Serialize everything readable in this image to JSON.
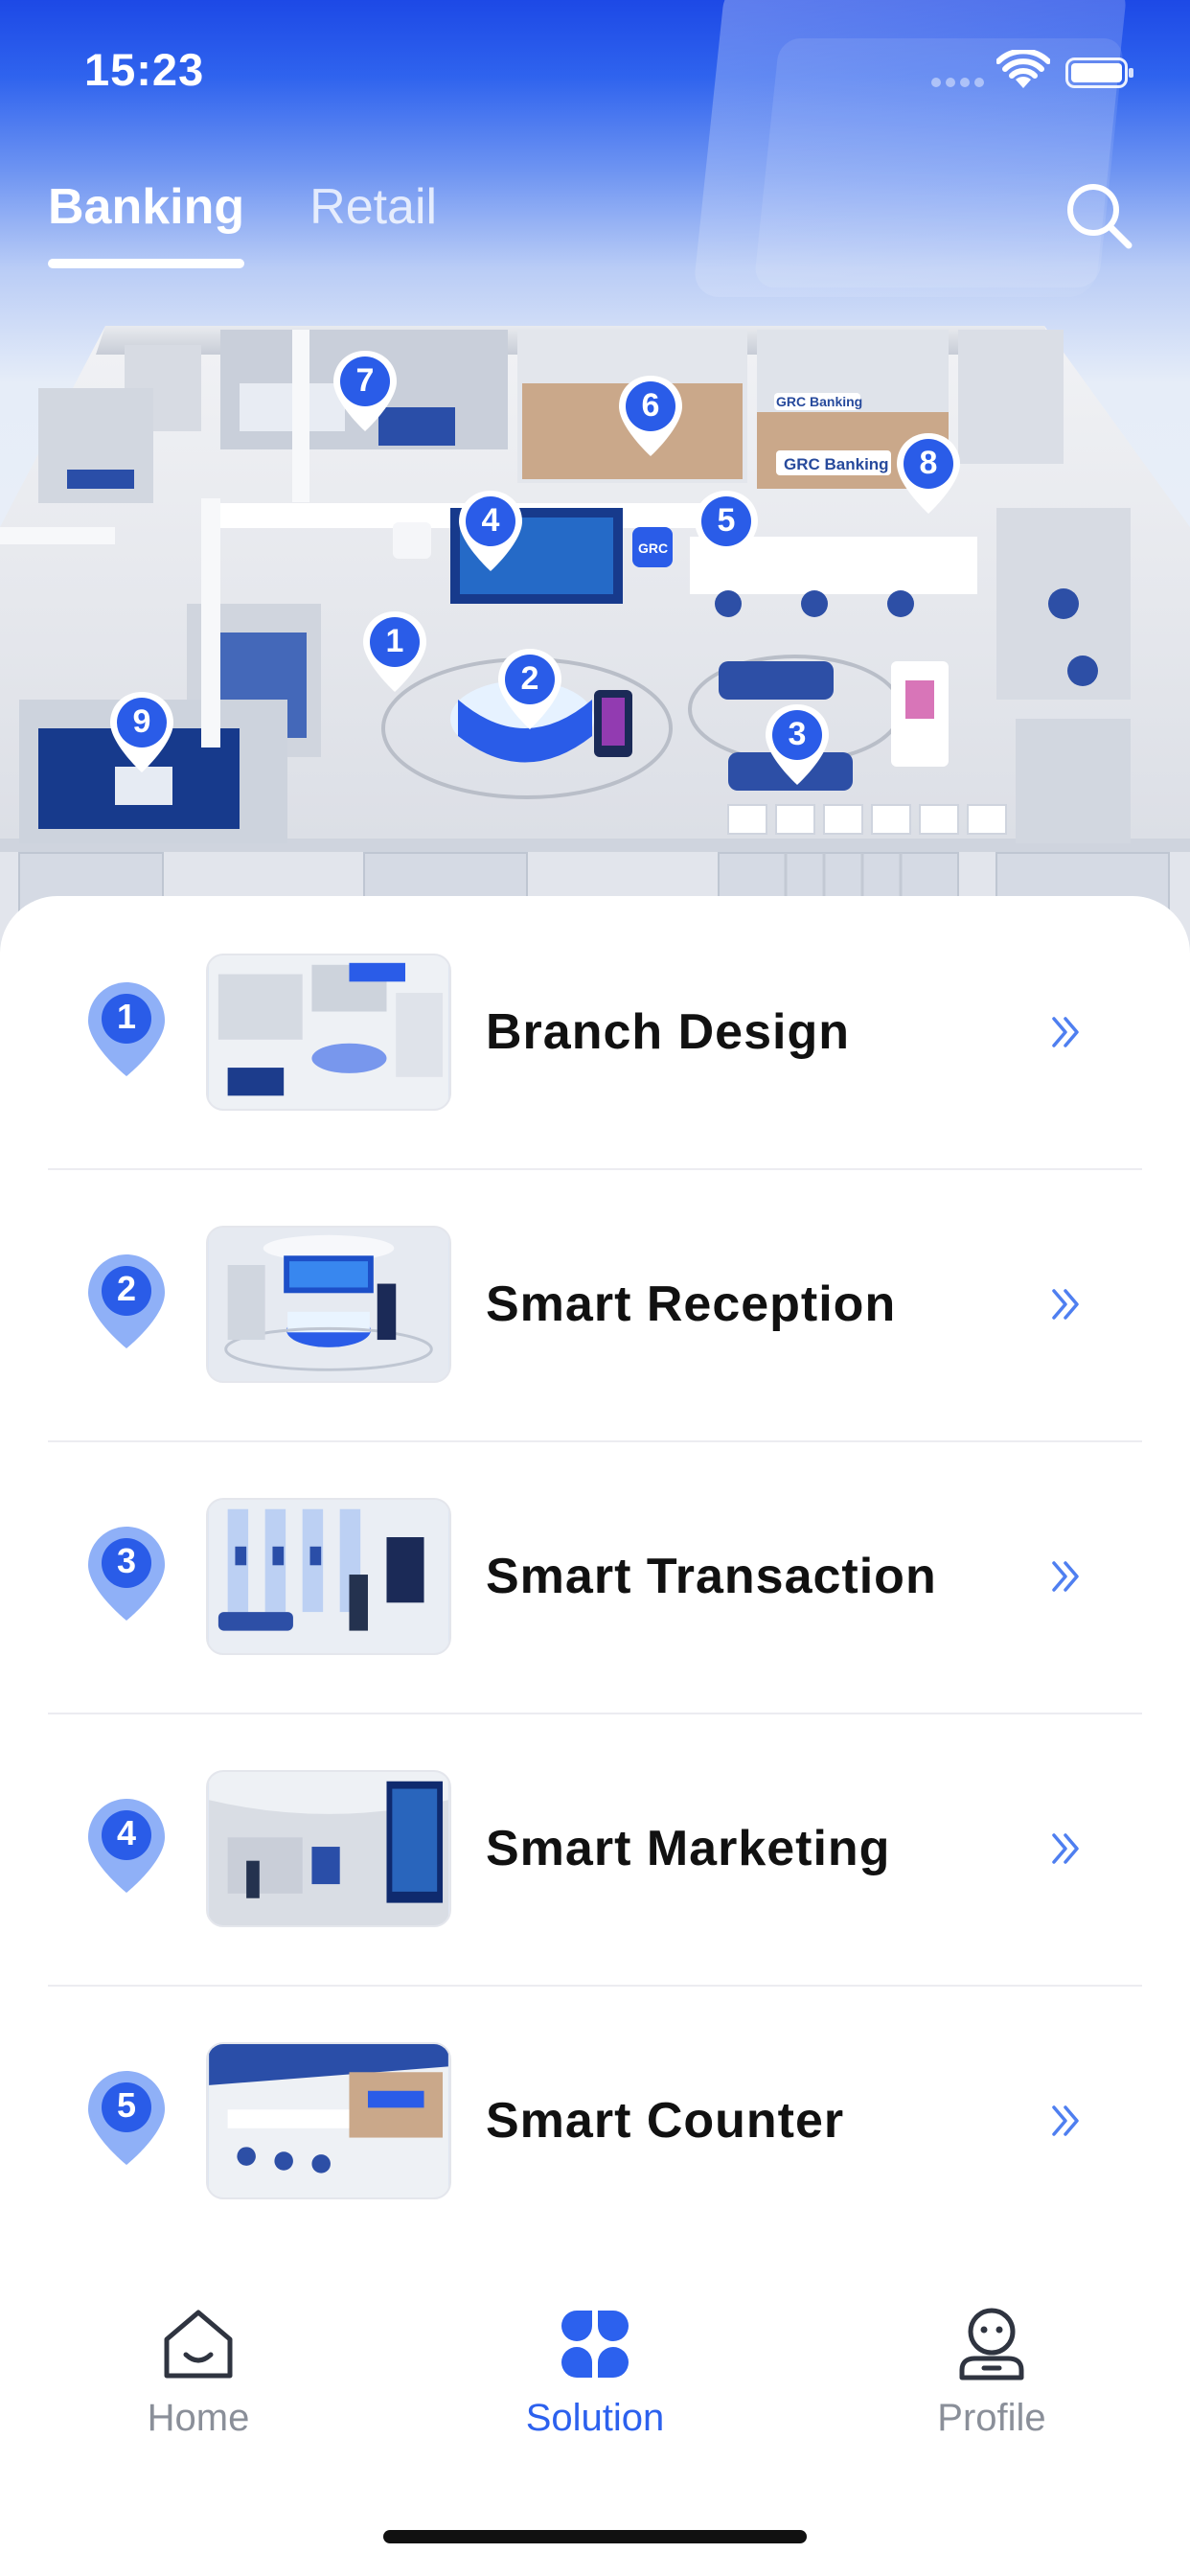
{
  "status_bar": {
    "time": "15:23"
  },
  "tabs": [
    {
      "label": "Banking",
      "active": true
    },
    {
      "label": "Retail",
      "active": false
    }
  ],
  "icons": {
    "search": "search-icon",
    "chevron": "double-chevron-right-icon",
    "pin": "map-pin-icon"
  },
  "map_pins": [
    {
      "number": "1"
    },
    {
      "number": "2"
    },
    {
      "number": "3"
    },
    {
      "number": "4"
    },
    {
      "number": "5"
    },
    {
      "number": "6"
    },
    {
      "number": "7"
    },
    {
      "number": "8"
    },
    {
      "number": "9"
    }
  ],
  "floorplan_signs": {
    "brand_a": "GRC Banking",
    "brand_b": "GRC Banking",
    "logo": "GRC"
  },
  "solutions": [
    {
      "number": "1",
      "title": "Branch Design"
    },
    {
      "number": "2",
      "title": "Smart Reception"
    },
    {
      "number": "3",
      "title": "Smart Transaction"
    },
    {
      "number": "4",
      "title": "Smart Marketing"
    },
    {
      "number": "5",
      "title": "Smart Counter"
    }
  ],
  "bottom_nav": [
    {
      "label": "Home",
      "icon": "home-icon",
      "active": false
    },
    {
      "label": "Solution",
      "icon": "grid-clover-icon",
      "active": true
    },
    {
      "label": "Profile",
      "icon": "profile-icon",
      "active": false
    }
  ],
  "colors": {
    "accent": "#2c61ee",
    "pin": "#2a5ce8",
    "pin_light": "#8fb0f7",
    "inactive": "#8a8f99"
  }
}
